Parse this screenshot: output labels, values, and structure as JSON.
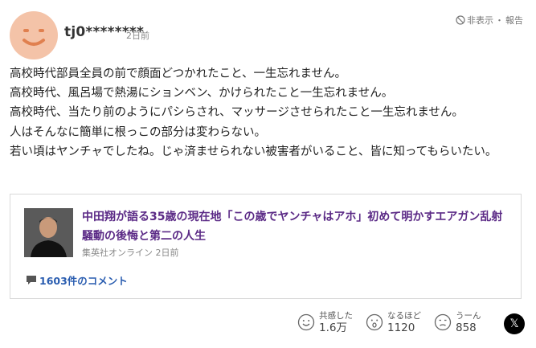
{
  "header": {
    "username": "tj0********",
    "time": "2日前",
    "hide_label": "非表示",
    "separator": "・",
    "report_label": "報告"
  },
  "comment": {
    "lines": [
      "高校時代部員全員の前で顔面どつかれたこと、一生忘れません。",
      "高校時代、風呂場で熱湯にションベン、かけられたこと一生忘れません。",
      "高校時代、当たり前のようにパシらされ、マッサージさせられたこと一生忘れません。",
      "人はそんなに簡単に根っこの部分は変わらない。",
      "若い頃はヤンチャでしたね。じゃ済ませられない被害者がいること、皆に知ってもらいたい。"
    ]
  },
  "article": {
    "title": "中田翔が語る35歳の現在地「この歳でヤンチャはアホ」初めて明かすエアガン乱射騒動の後悔と第二の人生",
    "source": "集英社オンライン",
    "time": "2日前",
    "comment_count": "1603件のコメント"
  },
  "reactions": [
    {
      "label": "共感した",
      "count": "1.6万",
      "icon": "smile-face-icon"
    },
    {
      "label": "なるほど",
      "count": "1120",
      "icon": "surprised-face-icon"
    },
    {
      "label": "うーん",
      "count": "858",
      "icon": "thinking-face-icon"
    }
  ],
  "share": {
    "x_label": "𝕏"
  },
  "colors": {
    "avatar_bg": "#f4c3a8",
    "article_title": "#5b2a86",
    "comment_link": "#2a5db0"
  }
}
